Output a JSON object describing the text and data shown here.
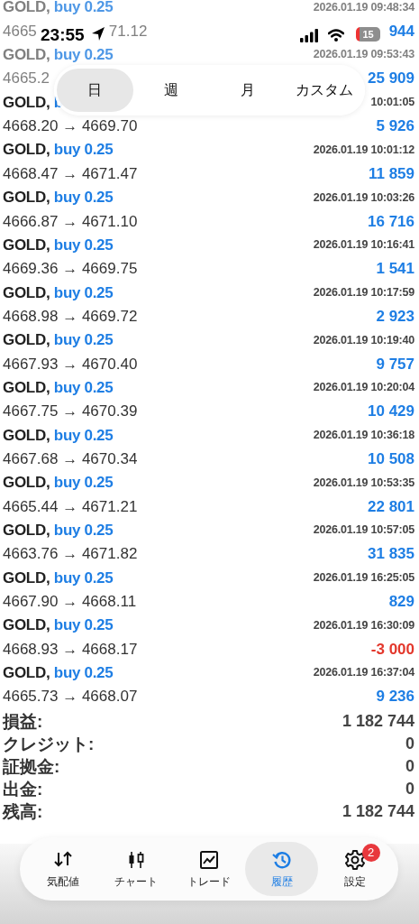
{
  "status_bar": {
    "time": "23:55",
    "battery": "15"
  },
  "period_tabs": [
    {
      "label": "日",
      "selected": true
    },
    {
      "label": "週",
      "selected": false
    },
    {
      "label": "月",
      "selected": false
    },
    {
      "label": "カスタム",
      "selected": false
    }
  ],
  "deals": [
    {
      "symbol": "GOLD,",
      "side": "buy 0.25",
      "time": "2026.01.19 09:48:34",
      "price": "4665",
      "price_tail": "71.12",
      "profit": "944",
      "color": "#1e7ee4",
      "faded": true
    },
    {
      "symbol": "GOLD,",
      "side": "buy 0.25",
      "time": "2026.01.19 09:53:43",
      "price": "4665.2",
      "profit": "25 909",
      "color": "#1e7ee4",
      "faded": true
    },
    {
      "symbol": "GOLD,",
      "side": "b",
      "time": "10:01:05",
      "price": "4668.20 → 4669.70",
      "profit": "5 926",
      "color": "#1e7ee4",
      "faded": false
    },
    {
      "symbol": "GOLD,",
      "side": "buy 0.25",
      "time": "2026.01.19 10:01:12",
      "price": "4668.47 → 4671.47",
      "profit": "11 859",
      "color": "#1e7ee4",
      "faded": false
    },
    {
      "symbol": "GOLD,",
      "side": "buy 0.25",
      "time": "2026.01.19 10:03:26",
      "price": "4666.87 → 4671.10",
      "profit": "16 716",
      "color": "#1e7ee4",
      "faded": false
    },
    {
      "symbol": "GOLD,",
      "side": "buy 0.25",
      "time": "2026.01.19 10:16:41",
      "price": "4669.36 → 4669.75",
      "profit": "1 541",
      "color": "#1e7ee4",
      "faded": false
    },
    {
      "symbol": "GOLD,",
      "side": "buy 0.25",
      "time": "2026.01.19 10:17:59",
      "price": "4668.98 → 4669.72",
      "profit": "2 923",
      "color": "#1e7ee4",
      "faded": false
    },
    {
      "symbol": "GOLD,",
      "side": "buy 0.25",
      "time": "2026.01.19 10:19:40",
      "price": "4667.93 → 4670.40",
      "profit": "9 757",
      "color": "#1e7ee4",
      "faded": false
    },
    {
      "symbol": "GOLD,",
      "side": "buy 0.25",
      "time": "2026.01.19 10:20:04",
      "price": "4667.75 → 4670.39",
      "profit": "10 429",
      "color": "#1e7ee4",
      "faded": false
    },
    {
      "symbol": "GOLD,",
      "side": "buy 0.25",
      "time": "2026.01.19 10:36:18",
      "price": "4667.68 → 4670.34",
      "profit": "10 508",
      "color": "#1e7ee4",
      "faded": false
    },
    {
      "symbol": "GOLD,",
      "side": "buy 0.25",
      "time": "2026.01.19 10:53:35",
      "price": "4665.44 → 4671.21",
      "profit": "22 801",
      "color": "#1e7ee4",
      "faded": false
    },
    {
      "symbol": "GOLD,",
      "side": "buy 0.25",
      "time": "2026.01.19 10:57:05",
      "price": "4663.76 → 4671.82",
      "profit": "31 835",
      "color": "#1e7ee4",
      "faded": false
    },
    {
      "symbol": "GOLD,",
      "side": "buy 0.25",
      "time": "2026.01.19 16:25:05",
      "price": "4667.90 → 4668.11",
      "profit": "829",
      "color": "#1e7ee4",
      "faded": false
    },
    {
      "symbol": "GOLD,",
      "side": "buy 0.25",
      "time": "2026.01.19 16:30:09",
      "price": "4668.93 → 4668.17",
      "profit": "-3 000",
      "color": "#e3372b",
      "faded": false
    },
    {
      "symbol": "GOLD,",
      "side": "buy 0.25",
      "time": "2026.01.19 16:37:04",
      "price": "4665.73 → 4668.07",
      "profit": "9 236",
      "color": "#1e7ee4",
      "faded": false
    }
  ],
  "summary": [
    {
      "label": "損益:",
      "value": "1 182 744"
    },
    {
      "label": "クレジット:",
      "value": "0"
    },
    {
      "label": "証拠金:",
      "value": "0"
    },
    {
      "label": "出金:",
      "value": "0"
    },
    {
      "label": "残高:",
      "value": "1 182 744"
    }
  ],
  "tab_bar": [
    {
      "kind": "quotes",
      "label": "気配値",
      "selected": false
    },
    {
      "kind": "chart",
      "label": "チャート",
      "selected": false
    },
    {
      "kind": "trade",
      "label": "トレード",
      "selected": false
    },
    {
      "kind": "history",
      "label": "履歴",
      "selected": true
    },
    {
      "kind": "settings",
      "label": "設定",
      "selected": false,
      "badge": "2"
    }
  ]
}
